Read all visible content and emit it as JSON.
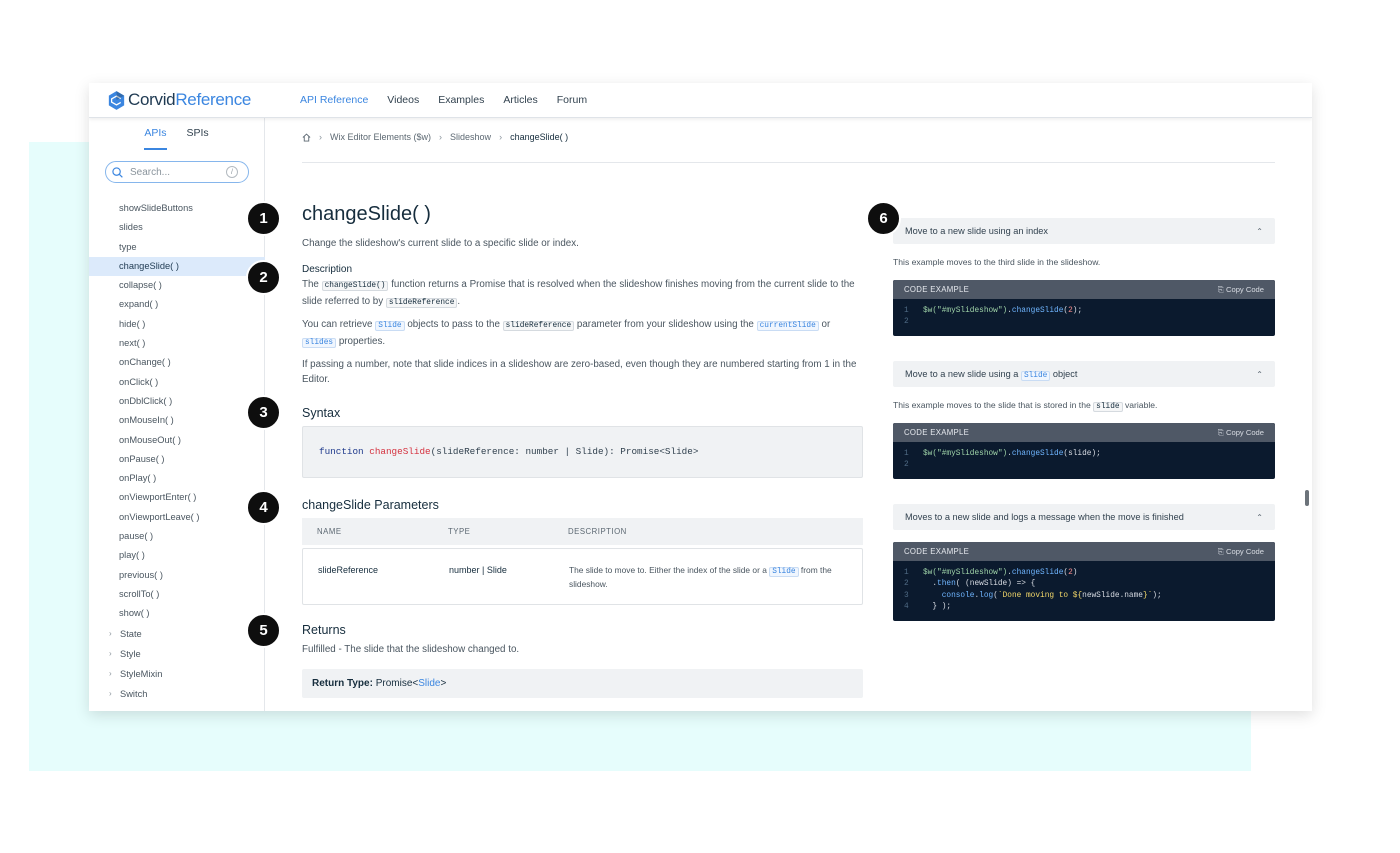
{
  "app": {
    "logo_part1": "Corvid",
    "logo_part2": "Reference"
  },
  "nav": {
    "links": [
      "API Reference",
      "Videos",
      "Examples",
      "Articles",
      "Forum"
    ]
  },
  "sidebar": {
    "tabs": [
      "APIs",
      "SPIs"
    ],
    "search_placeholder": "Search...",
    "search_shortcut": "/",
    "items": [
      "showSlideButtons",
      "slides",
      "type",
      "changeSlide( )",
      "collapse( )",
      "expand( )",
      "hide( )",
      "next( )",
      "onChange( )",
      "onClick( )",
      "onDblClick( )",
      "onMouseIn( )",
      "onMouseOut( )",
      "onPause( )",
      "onPlay( )",
      "onViewportEnter( )",
      "onViewportLeave( )",
      "pause( )",
      "play( )",
      "previous( )",
      "scrollTo( )",
      "show( )"
    ],
    "groups": [
      "State",
      "Style",
      "StyleMixin",
      "Switch"
    ]
  },
  "breadcrumb": {
    "items": [
      "Wix Editor Elements ($w)",
      "Slideshow"
    ],
    "current": "changeSlide( )"
  },
  "main": {
    "title": "changeSlide( )",
    "summary": "Change the slideshow's current slide to a specific slide or index.",
    "description_heading": "Description",
    "p1": {
      "a": "The",
      "code1": "changeSlide()",
      "b": "function returns a Promise that is resolved when the slideshow finishes moving from the current slide to the slide referred to by",
      "code2": "slideReference",
      "c": "."
    },
    "p2": {
      "a": "You can retrieve",
      "code1": "Slide",
      "b": "objects to pass to the",
      "code2": "slideReference",
      "c": "parameter from your slideshow using the",
      "code3": "currentSlide",
      "d": "or",
      "code4": "slides",
      "e": "properties."
    },
    "p3": "If passing a number, note that slide indices in a slideshow are zero-based, even though they are numbered starting from 1 in the Editor.",
    "syntax_heading": "Syntax",
    "syntax": {
      "kw": "function",
      "fn": "changeSlide",
      "rest": "(slideReference: number | Slide): Promise<Slide>"
    },
    "params_heading": "changeSlide Parameters",
    "params_columns": [
      "NAME",
      "TYPE",
      "DESCRIPTION"
    ],
    "param": {
      "name": "slideReference",
      "type": "number | Slide",
      "desc_a": "The slide to move to. Either the index of the slide or a",
      "desc_code": "Slide",
      "desc_b": "from the slideshow."
    },
    "returns_heading": "Returns",
    "returns_text": "Fulfilled - The slide that the slideshow changed to.",
    "return_type_label": "Return Type:",
    "return_type_a": "Promise<",
    "return_type_link": "Slide",
    "return_type_b": ">"
  },
  "examples": [
    {
      "title": "Move to a new slide using an index",
      "sub": "This example moves to the third slide in the slideshow."
    },
    {
      "title_a": "Move to a new slide using a",
      "title_code": "Slide",
      "title_b": "object",
      "sub_a": "This example moves to the slide that is stored in the",
      "sub_code": "slide",
      "sub_b": "variable."
    },
    {
      "title": "Moves to a new slide and logs a message when the move is finished"
    }
  ],
  "code_cards": {
    "label": "CODE EXAMPLE",
    "copy": "Copy Code"
  },
  "markers": [
    "1",
    "2",
    "3",
    "4",
    "5",
    "6"
  ],
  "colors": {
    "accent": "#3b86e0",
    "teal_bg": "#e6fdfc",
    "code_bg": "#0b1a2e"
  }
}
